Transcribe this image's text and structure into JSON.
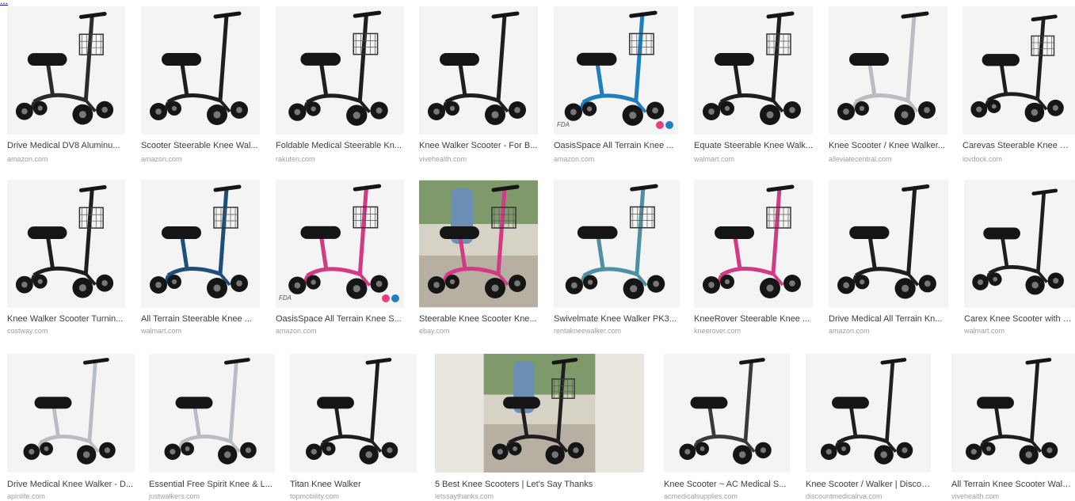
{
  "top_link": "...",
  "colors": {
    "frame": "#1e1e1e",
    "pad": "#151515",
    "wheel": "#151515",
    "blue": "#1e7fc0",
    "pink": "#d23a85",
    "teal": "#4f8fa3",
    "navy": "#1e4f7a",
    "silver": "#b9bcc0",
    "title": "#3c4043",
    "source": "#9aa0a6"
  },
  "rows": [
    {
      "items": [
        {
          "title": "Drive Medical DV8 Aluminu...",
          "source": "amazon.com",
          "frame": "#2b2b2b",
          "basket": true
        },
        {
          "title": "Scooter Steerable Knee Wal...",
          "source": "amazon.com",
          "frame": "#1e1e1e",
          "basket": false
        },
        {
          "title": "Foldable Medical Steerable Kn...",
          "source": "rakuten.com",
          "frame": "#1e1e1e",
          "basket": true
        },
        {
          "title": "Knee Walker Scooter - For B...",
          "source": "vivehealth.com",
          "frame": "#1e1e1e",
          "basket": false
        },
        {
          "title": "OasisSpace All Terrain Knee ...",
          "source": "amazon.com",
          "frame": "#1e7fc0",
          "basket": true,
          "badges": {
            "fda": "FDA",
            "dots": [
              "#e5407f",
              "#1e7fc0"
            ]
          }
        },
        {
          "title": "Equate Steerable Knee Walk...",
          "source": "walmart.com",
          "frame": "#1e1e1e",
          "basket": true
        },
        {
          "title": "Knee Scooter / Knee Walker...",
          "source": "alleviatecentral.com",
          "frame": "#b9bcc0",
          "basket": false
        },
        {
          "title": "Carevas Steerable Knee Wal...",
          "source": "lovdock.com",
          "frame": "#1e1e1e",
          "basket": true
        }
      ]
    },
    {
      "items": [
        {
          "title": "Knee Walker Scooter Turnin...",
          "source": "costway.com",
          "frame": "#1e1e1e",
          "basket": true
        },
        {
          "title": "All Terrain Steerable Knee ...",
          "source": "walmart.com",
          "frame": "#1e4f7a",
          "basket": true
        },
        {
          "title": "OasisSpace All Terrain Knee S...",
          "source": "amazon.com",
          "frame": "#d23a85",
          "basket": true,
          "badges": {
            "fda": "FDA",
            "dots": [
              "#e5407f",
              "#1e7fc0"
            ]
          }
        },
        {
          "title": "Steerable Knee Scooter Kne...",
          "source": "ebay.com",
          "frame": "#d23a85",
          "basket": true,
          "photo": true
        },
        {
          "title": "Swivelmate Knee Walker PK3...",
          "source": "rentakneewalker.com",
          "frame": "#4f8fa3",
          "basket": true
        },
        {
          "title": "KneeRover Steerable Knee ...",
          "source": "kneerover.com",
          "frame": "#d23a85",
          "basket": true
        },
        {
          "title": "Drive Medical All Terrain Kn...",
          "source": "amazon.com",
          "frame": "#1e1e1e",
          "basket": false
        },
        {
          "title": "Carex Knee Scooter with Pa...",
          "source": "walmart.com",
          "frame": "#1e1e1e",
          "basket": false
        }
      ]
    },
    {
      "items": [
        {
          "title": "Drive Medical Knee Walker - D...",
          "source": "apinlife.com",
          "frame": "#b9bcc0",
          "basket": false
        },
        {
          "title": "Essential Free Spirit Knee & L...",
          "source": "justwalkers.com",
          "frame": "#b9bcc0",
          "basket": false
        },
        {
          "title": "Titan Knee Walker",
          "source": "topmobility.com",
          "frame": "#1e1e1e",
          "basket": false
        },
        {
          "title": "5 Best Knee Scooters | Let's Say Thanks",
          "source": "letssaythanks.com",
          "frame": "#1e1e1e",
          "basket": true,
          "photo": true
        },
        {
          "title": "Knee Scooter ~ AC Medical S...",
          "source": "acmedicalsupplies.com",
          "frame": "#3a3a3a",
          "basket": false
        },
        {
          "title": "Knee Scooter / Walker | Discou...",
          "source": "discountmedicalrva.com",
          "frame": "#1e1e1e",
          "basket": false
        },
        {
          "title": "All Terrain Knee Scooter Walke...",
          "source": "vivehealth.com",
          "frame": "#1e1e1e",
          "basket": false
        }
      ]
    }
  ]
}
